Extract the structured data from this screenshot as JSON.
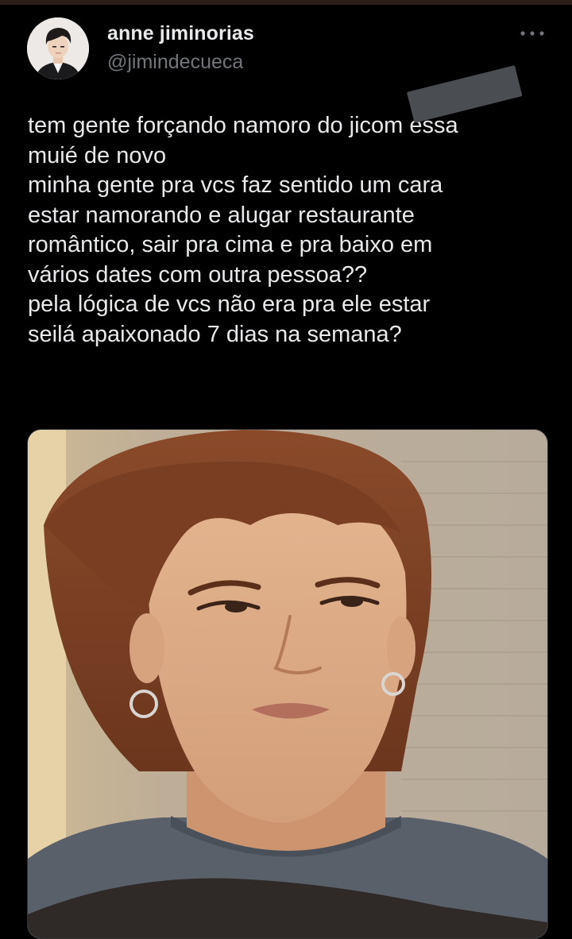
{
  "tweet": {
    "author": {
      "display_name": "anne jiminorias",
      "handle": "@jimindecueca",
      "avatar_icon": "profile-avatar"
    },
    "more_icon": "more-horizontal-icon",
    "text_lines": [
      "tem gente forçando namoro do jicom essa",
      "muié de novo",
      "minha gente pra vcs faz sentido um cara",
      "estar namorando e alugar restaurante",
      "romântico, sair pra cima e pra baixo em",
      "vários dates com outra pessoa??",
      "pela lógica de vcs não era pra ele estar",
      "seilá apaixonado 7 dias na semana?"
    ],
    "media": {
      "kind": "photo"
    }
  },
  "colors": {
    "background": "#000000",
    "primary_text": "#e7e9ea",
    "secondary_text": "#71767b",
    "censor_bar": "#4a4d51"
  }
}
